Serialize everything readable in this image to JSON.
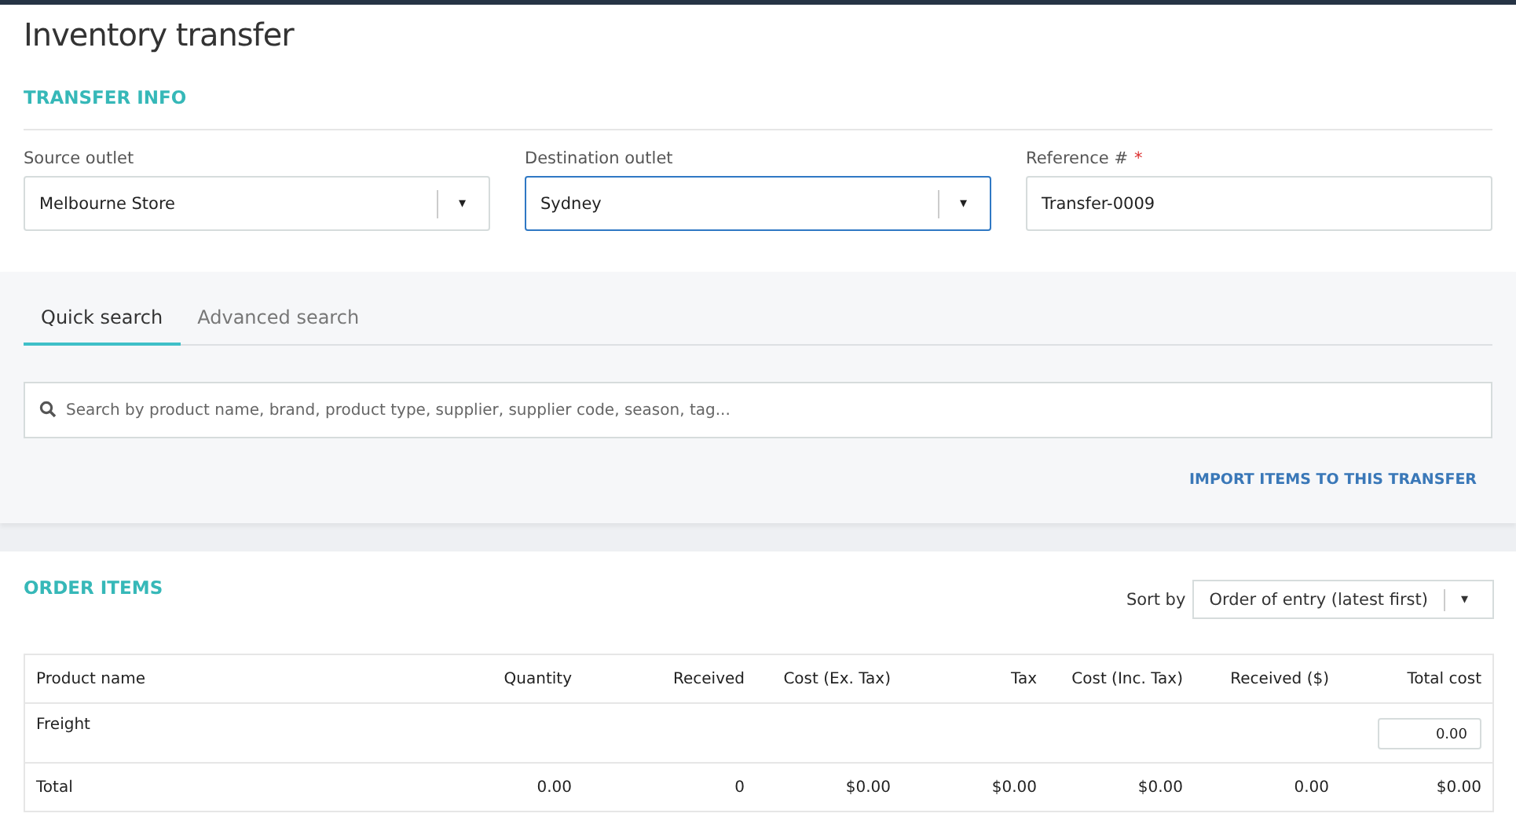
{
  "page": {
    "title": "Inventory transfer"
  },
  "transfer_info": {
    "heading": "TRANSFER INFO",
    "fields": [
      {
        "kind": "select",
        "label": "Source outlet",
        "value": "Melbourne Store",
        "focused": false,
        "arrow": "▾"
      },
      {
        "kind": "select",
        "label": "Destination outlet",
        "value": "Sydney",
        "focused": true,
        "arrow": "▾"
      },
      {
        "kind": "text",
        "label": "Reference #",
        "required_mark": "*",
        "value": "Transfer-0009",
        "focused": false
      }
    ]
  },
  "search": {
    "tabs": [
      {
        "label": "Quick search",
        "selected": true
      },
      {
        "label": "Advanced search",
        "selected": false
      }
    ],
    "placeholder": "Search by product name, brand, product type, supplier, supplier code, season, tag...",
    "import_link": "IMPORT ITEMS TO THIS TRANSFER"
  },
  "order_items": {
    "heading": "ORDER ITEMS",
    "sort_label": "Sort by",
    "sort_value": "Order of entry (latest first)",
    "sort_arrow": "▾",
    "table": {
      "columns": [
        "Product name",
        "Quantity",
        "Received",
        "Cost (Ex. Tax)",
        "Tax",
        "Cost (Inc. Tax)",
        "Received ($)",
        "Total cost"
      ],
      "rows": [
        {
          "kind": "freight",
          "name": "Freight",
          "total_input": "0.00"
        },
        {
          "kind": "total",
          "cells": [
            "Total",
            "0.00",
            "0",
            "$0.00",
            "$0.00",
            "$0.00",
            "0.00",
            "$0.00"
          ]
        }
      ]
    }
  }
}
